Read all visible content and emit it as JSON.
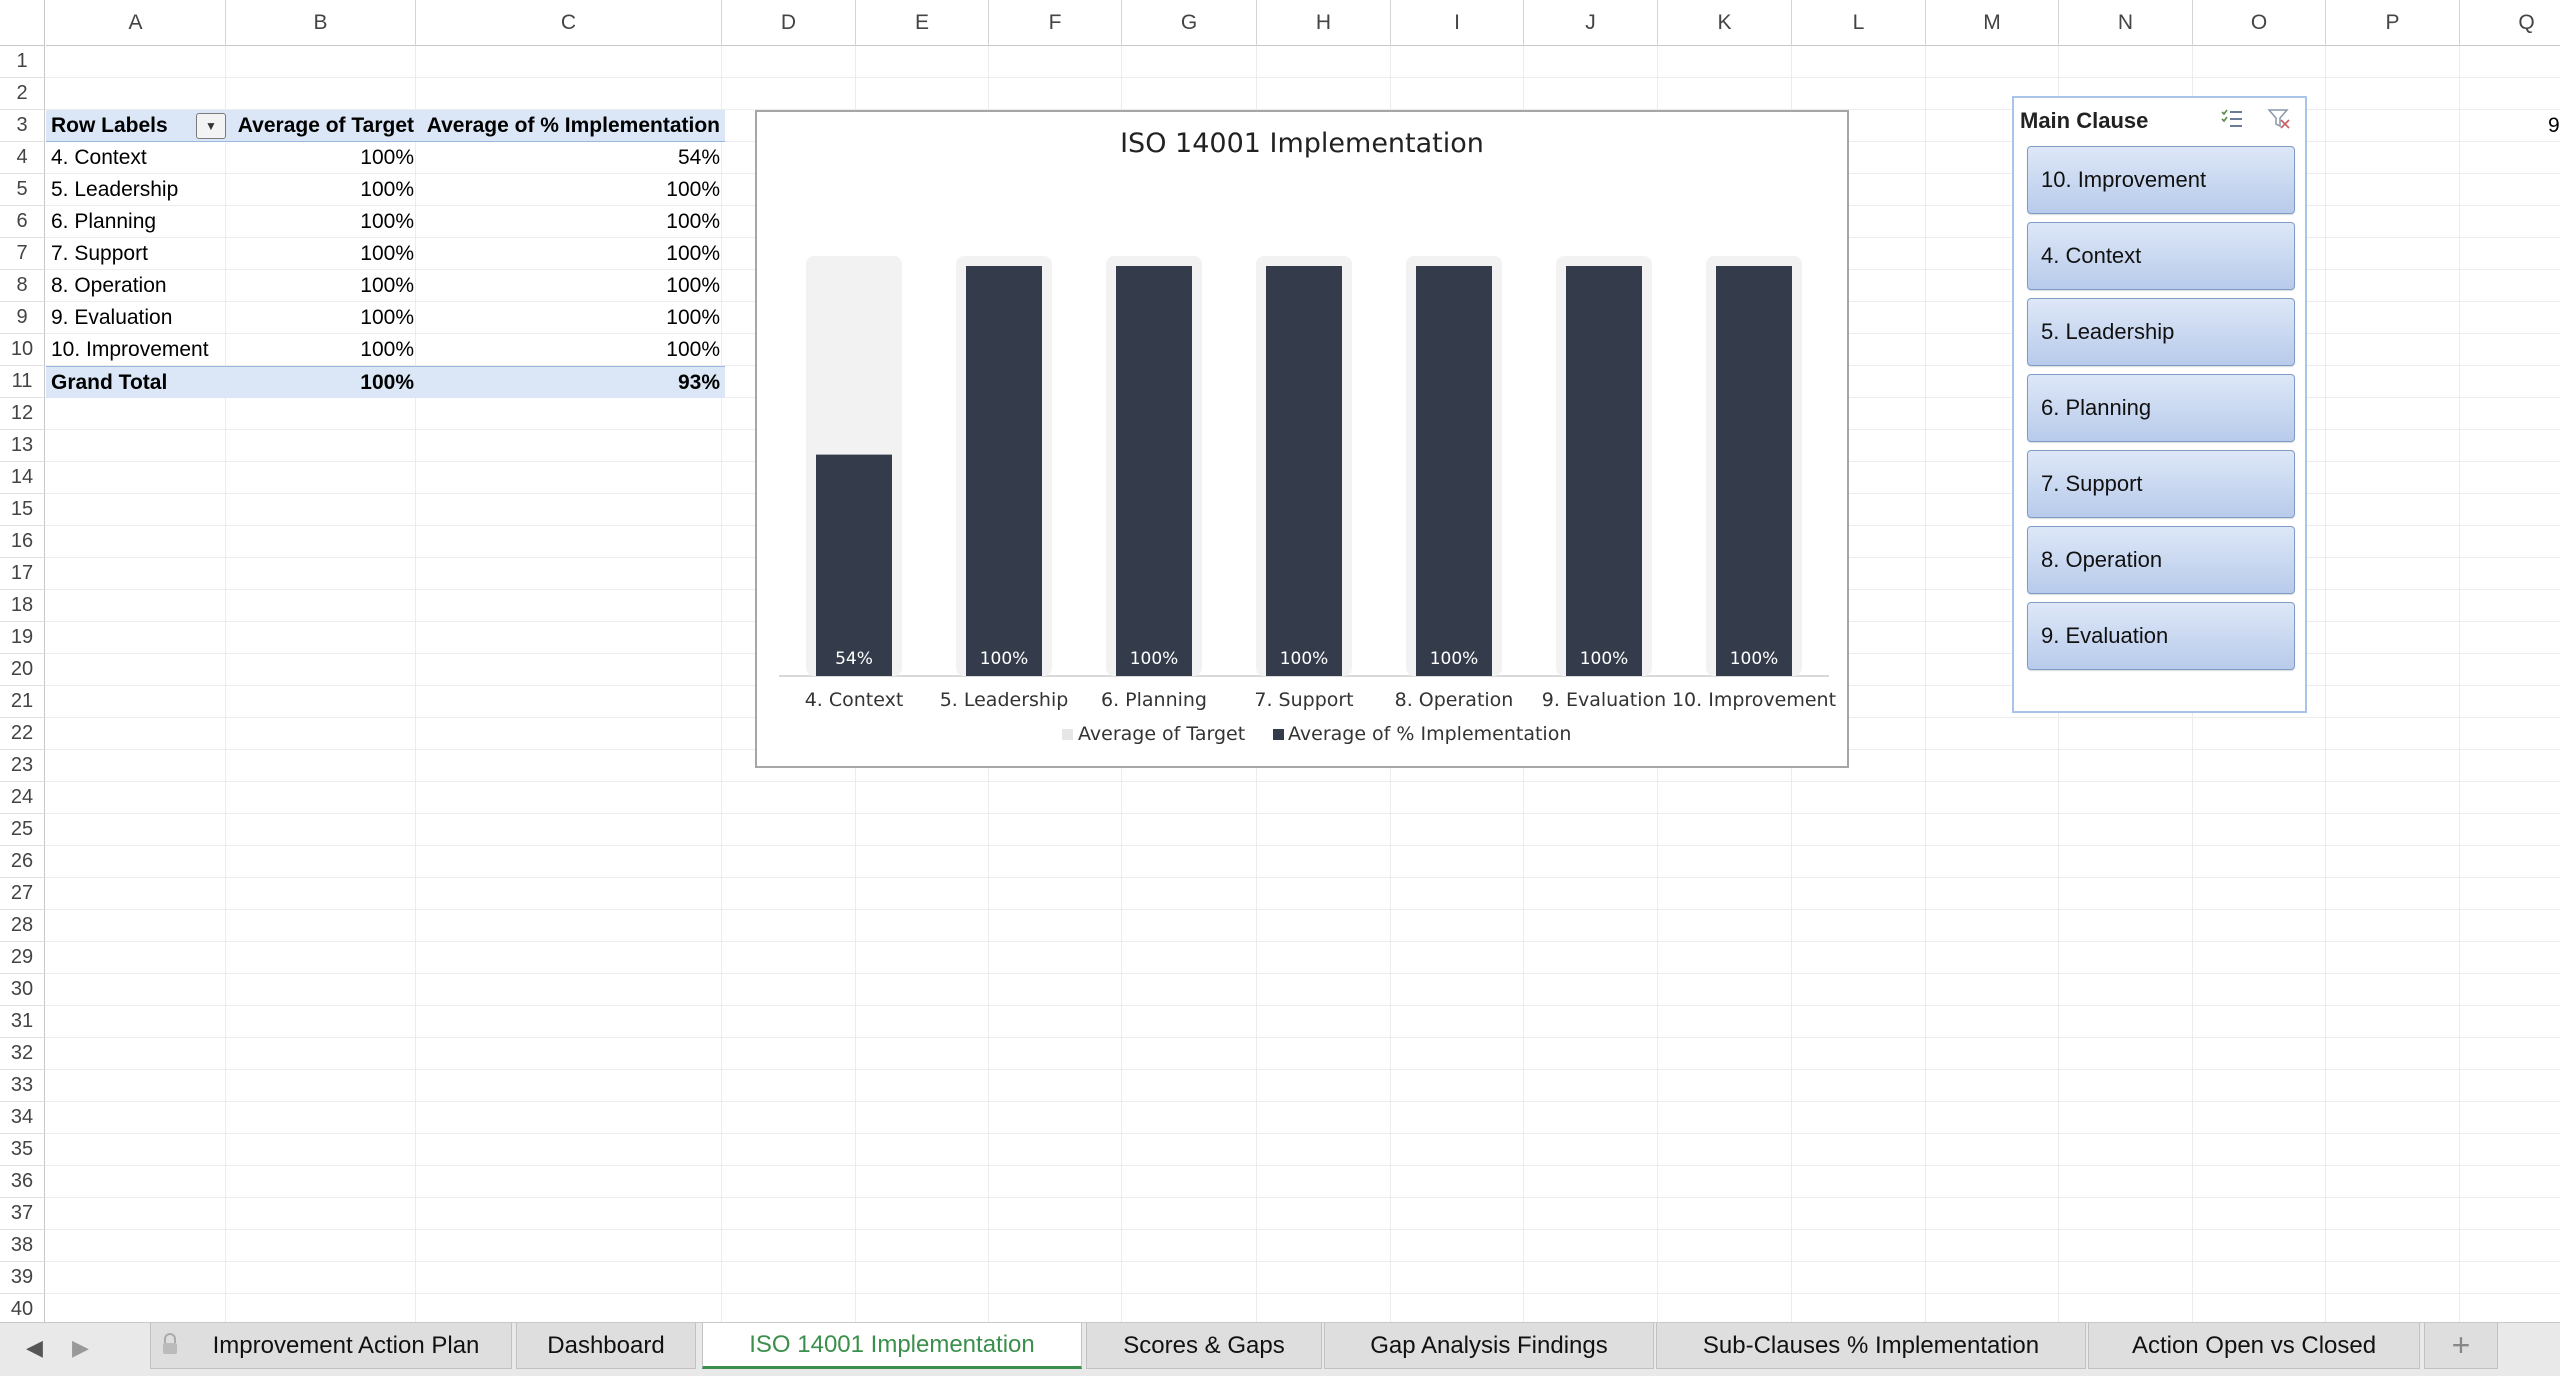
{
  "columns": [
    "A",
    "B",
    "C",
    "D",
    "E",
    "F",
    "G",
    "H",
    "I",
    "J",
    "K",
    "L",
    "M",
    "N",
    "O",
    "P",
    "Q"
  ],
  "rows": [
    "1",
    "2",
    "3",
    "4",
    "5",
    "6",
    "7",
    "8",
    "9",
    "10",
    "11",
    "12",
    "13",
    "14",
    "15",
    "16",
    "17",
    "18",
    "19",
    "20",
    "21",
    "22",
    "23",
    "24",
    "25",
    "26",
    "27",
    "28",
    "29",
    "30",
    "31",
    "32",
    "33",
    "34",
    "35",
    "36",
    "37",
    "38",
    "39",
    "40"
  ],
  "edge_text": "9",
  "pivot": {
    "headers": {
      "row_labels": "Row Labels",
      "avg_target": "Average of Target",
      "avg_impl": "Average of % Implementation"
    },
    "rows": [
      {
        "label": "4. Context",
        "target": "100%",
        "impl": "54%"
      },
      {
        "label": "5. Leadership",
        "target": "100%",
        "impl": "100%"
      },
      {
        "label": "6. Planning",
        "target": "100%",
        "impl": "100%"
      },
      {
        "label": "7. Support",
        "target": "100%",
        "impl": "100%"
      },
      {
        "label": "8. Operation",
        "target": "100%",
        "impl": "100%"
      },
      {
        "label": "9. Evaluation",
        "target": "100%",
        "impl": "100%"
      },
      {
        "label": "10. Improvement",
        "target": "100%",
        "impl": "100%"
      }
    ],
    "total": {
      "label": "Grand Total",
      "target": "100%",
      "impl": "93%"
    }
  },
  "chart_data": {
    "type": "bar",
    "title": "ISO 14001 Implementation",
    "categories": [
      "4. Context",
      "5. Leadership",
      "6. Planning",
      "7. Support",
      "8. Operation",
      "9. Evaluation",
      "10. Improvement"
    ],
    "series": [
      {
        "name": "Average of Target",
        "values": [
          100,
          100,
          100,
          100,
          100,
          100,
          100
        ],
        "color": "#f2f2f2"
      },
      {
        "name": "Average of % Implementation",
        "values": [
          54,
          100,
          100,
          100,
          100,
          100,
          100
        ],
        "color": "#343c4b"
      }
    ],
    "data_labels": [
      "54%",
      "100%",
      "100%",
      "100%",
      "100%",
      "100%",
      "100%"
    ],
    "ylim": [
      0,
      100
    ],
    "grid": false,
    "legend": "bottom"
  },
  "slicer": {
    "title": "Main Clause",
    "multi_select_icon": "multi-select-icon",
    "clear_filter_icon": "clear-filter-icon",
    "items": [
      "10. Improvement",
      "4. Context",
      "5. Leadership",
      "6. Planning",
      "7. Support",
      "8. Operation",
      "9. Evaluation"
    ]
  },
  "tabs": [
    {
      "label": "Improvement Action Plan",
      "locked": true
    },
    {
      "label": "Dashboard"
    },
    {
      "label": "ISO 14001 Implementation",
      "active": true
    },
    {
      "label": "Scores & Gaps"
    },
    {
      "label": "Gap Analysis Findings"
    },
    {
      "label": "Sub-Clauses % Implementation"
    },
    {
      "label": "Action Open vs Closed"
    }
  ],
  "add_sheet_label": "+",
  "colors": {
    "accent_tab": "#3a8f4c",
    "bar_dark": "#343c4b",
    "bar_light": "#f2f2f2",
    "pivot_fill": "#dbe7f6"
  }
}
